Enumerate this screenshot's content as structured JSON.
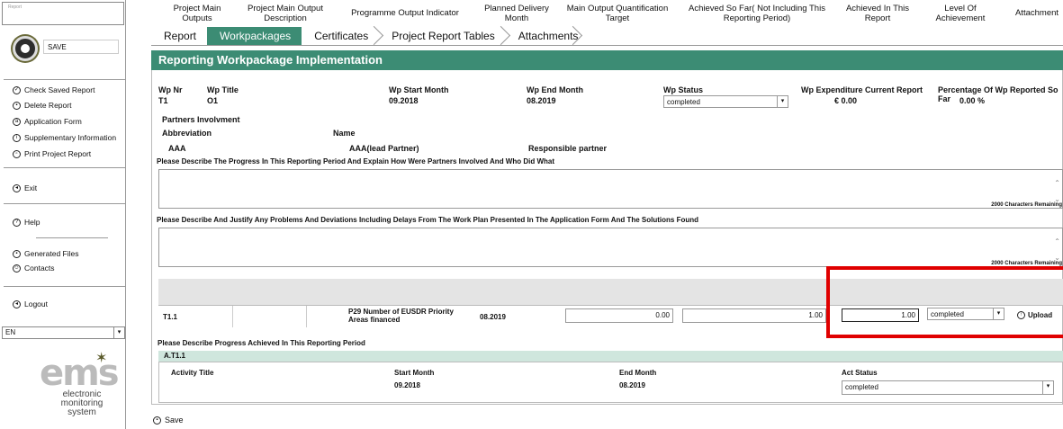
{
  "sidebar": {
    "top_input_label": "Report",
    "save_label": "SAVE",
    "links": [
      {
        "label": "Check Saved Report",
        "icon": "check-icon"
      },
      {
        "label": "Delete Report",
        "icon": "delete-icon"
      },
      {
        "label": "Application Form",
        "icon": "form-icon"
      },
      {
        "label": "Supplementary Information",
        "icon": "info-icon"
      },
      {
        "label": "Print Project Report",
        "icon": "print-icon"
      },
      {
        "label": "Exit",
        "icon": "exit-icon"
      },
      {
        "label": "Help",
        "icon": "help-icon"
      },
      {
        "label": "Generated Files",
        "icon": "files-icon"
      },
      {
        "label": "Contacts",
        "icon": "contacts-icon"
      },
      {
        "label": "Logout",
        "icon": "logout-icon"
      }
    ],
    "language": "EN",
    "logo_text": "ems",
    "logo_subtitle_1": "electronic",
    "logo_subtitle_2": "monitoring",
    "logo_subtitle_3": "system"
  },
  "tabs": [
    "Report",
    "Workpackages",
    "Certificates",
    "Project Report Tables",
    "Attachments"
  ],
  "section_title": "Reporting Workpackage Implementation",
  "wp": {
    "nr_label": "Wp Nr",
    "nr": "T1",
    "title_label": "Wp Title",
    "title": "O1",
    "start_label": "Wp Start Month",
    "start": "09.2018",
    "end_label": "Wp End Month",
    "end": "08.2019",
    "status_label": "Wp Status",
    "status": "completed",
    "expenditure_label": "Wp Expenditure Current Report",
    "expenditure": "€ 0.00",
    "percent_label": "Percentage Of Wp Reported So Far",
    "percent": "0.00 %"
  },
  "partners": {
    "heading": "Partners Involvment",
    "abbr_label": "Abbreviation",
    "name_label": "Name",
    "abbr": "AAA",
    "name": "AAA(lead Partner)",
    "role": "Responsible partner"
  },
  "progress_q": "Please Describe The Progress In This Reporting Period And Explain How Were Partners Involved And Who Did What",
  "problems_q": "Please Describe And Justify Any Problems And Deviations Including Delays From The Work Plan Presented In The Application Form And The Solutions Found",
  "chars_remaining": "2000 Characters Remaining",
  "outputs": {
    "headers": [
      "Project Main Outputs",
      "Project Main Output Description",
      "Programme Output Indicator",
      "Planned Delivery Month",
      "Main Output Quantification Target",
      "Achieved So Far( Not Including This Reporting Period)",
      "Achieved In This Report",
      "Level Of Achievement",
      "Attachment"
    ],
    "row": {
      "output": "T1.1",
      "description": "",
      "indicator": "P29 Number of EUSDR Priority Areas financed",
      "month": "08.2019",
      "target": "0.00",
      "achieved_so_far": "1.00",
      "achieved_now": "1.00",
      "level": "completed",
      "upload": "Upload"
    }
  },
  "progress_achieved_label": "Please Describe Progress Achieved In This Reporting Period",
  "activity": {
    "id": "A.T1.1",
    "title_label": "Activity Title",
    "start_label": "Start Month",
    "start": "09.2018",
    "end_label": "End Month",
    "end": "08.2019",
    "status_label": "Act Status",
    "status": "completed"
  },
  "bottom_save": "Save",
  "colors": {
    "accent": "#3c8c74",
    "highlight": "#e00000"
  }
}
